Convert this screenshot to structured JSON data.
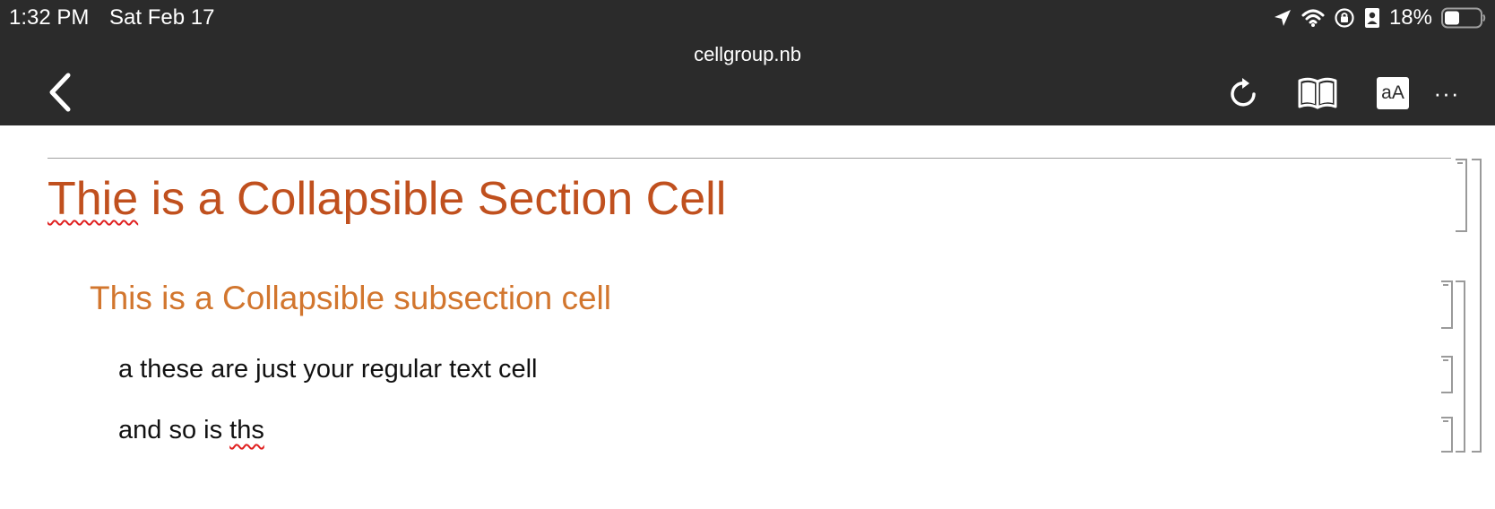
{
  "status_bar": {
    "time": "1:32 PM",
    "date": "Sat Feb 17",
    "battery_percent": "18%",
    "battery_level": 0.18
  },
  "toolbar": {
    "document_title": "cellgroup.nb",
    "font_button_label": "aA",
    "more_label": "···"
  },
  "notebook": {
    "section_cell": {
      "misspelled_word": "Thie",
      "rest": " is a Collapsible Section Cell"
    },
    "subsection_cell": {
      "text": "This is a Collapsible subsection cell"
    },
    "text_cell_1": {
      "text": "a these are just your regular text cell"
    },
    "text_cell_2": {
      "prefix": "and so is ",
      "misspelled_word": "ths"
    }
  },
  "colors": {
    "toolbar_bg": "#2b2b2b",
    "section_color": "#c0501e",
    "subsection_color": "#d2762e",
    "text_color": "#111111",
    "bracket_color": "#9a9a9a",
    "spellcheck_color": "#e02020"
  },
  "icons": [
    "back-chevron-icon",
    "location-arrow-icon",
    "wifi-icon",
    "rotation-lock-icon",
    "contact-badge-icon",
    "battery-icon",
    "reload-icon",
    "book-icon",
    "font-size-icon",
    "more-icon"
  ]
}
